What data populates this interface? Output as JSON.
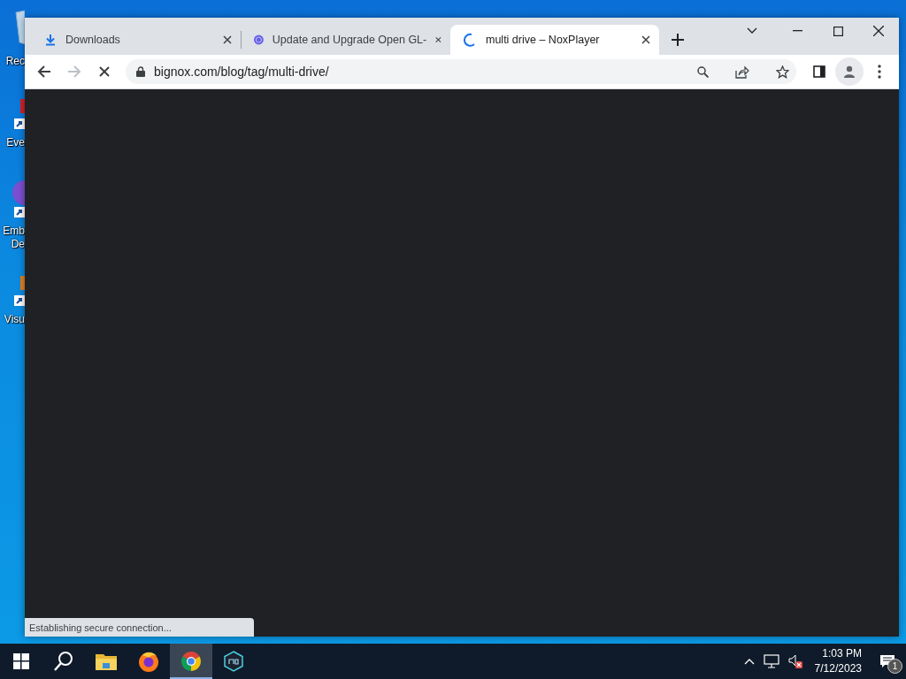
{
  "desktop_icons": [
    {
      "kind": "recycle",
      "lines": [
        "Rec"
      ]
    },
    {
      "kind": "shortcut",
      "lines": [
        "Eve"
      ]
    },
    {
      "kind": "shortcut",
      "lines": [
        "Emb",
        "De"
      ]
    },
    {
      "kind": "shortcut",
      "lines": [
        "Visu"
      ]
    }
  ],
  "browser": {
    "tabs": [
      {
        "kind": "download",
        "title": "Downloads",
        "selected": false
      },
      {
        "kind": "nox",
        "title": "Update and Upgrade Open GL-",
        "selected": false
      },
      {
        "kind": "loading",
        "title": "multi drive – NoxPlayer",
        "selected": true
      }
    ],
    "toolbar": {
      "back_disabled": false,
      "forward_disabled": true,
      "loading": true,
      "address": "bignox.com/blog/tag/multi-drive/"
    },
    "status_bubble": "Establishing secure connection..."
  },
  "taskbar": {
    "apps": [
      {
        "kind": "search",
        "selected": false
      },
      {
        "kind": "explorer",
        "selected": false
      },
      {
        "kind": "firefox",
        "selected": false
      },
      {
        "kind": "chrome",
        "selected": true
      },
      {
        "kind": "nox",
        "selected": false
      }
    ],
    "time": "1:03 PM",
    "date": "7/12/2023",
    "notifications": "1"
  }
}
